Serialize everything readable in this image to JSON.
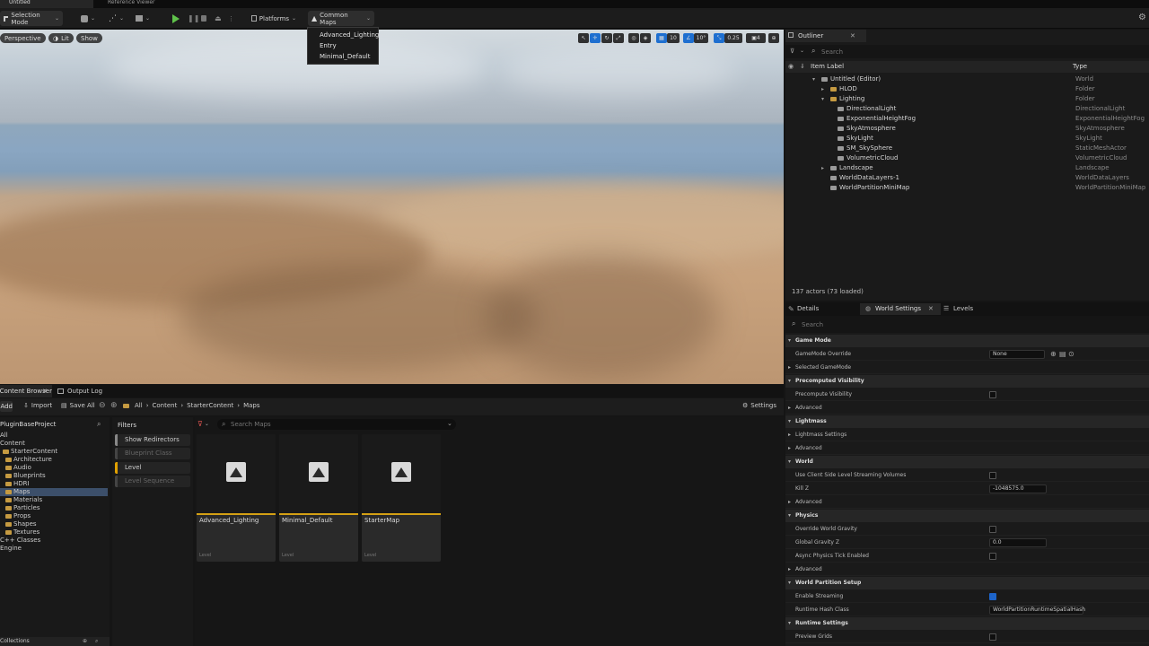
{
  "tabs": {
    "active": "Untitled",
    "second": "Reference Viewer"
  },
  "toolbar": {
    "selection_mode": "Selection Mode",
    "platforms": "Platforms",
    "common_maps": "Common Maps"
  },
  "maps_dropdown": {
    "items": [
      "Advanced_Lighting",
      "Entry",
      "Minimal_Default"
    ]
  },
  "viewport": {
    "perspective": "Perspective",
    "lit": "Lit",
    "show": "Show",
    "grid_snap": "10",
    "rot_snap": "10°",
    "scale_snap": "0.25",
    "camera_speed": "4"
  },
  "content_browser": {
    "tab_label": "Content Browser",
    "output_log": "Output Log",
    "add": "Add",
    "import": "Import",
    "save_all": "Save All",
    "crumbs": [
      "All",
      "Content",
      "StarterContent",
      "Maps"
    ],
    "settings": "Settings",
    "project": "PluginBaseProject",
    "tree": [
      {
        "label": "All",
        "indent": 0
      },
      {
        "label": "Content",
        "indent": 0
      },
      {
        "label": "StarterContent",
        "indent": 1
      },
      {
        "label": "Architecture",
        "indent": 2
      },
      {
        "label": "Audio",
        "indent": 2
      },
      {
        "label": "Blueprints",
        "indent": 2
      },
      {
        "label": "HDRI",
        "indent": 2
      },
      {
        "label": "Maps",
        "indent": 2
      },
      {
        "label": "Materials",
        "indent": 2
      },
      {
        "label": "Particles",
        "indent": 2
      },
      {
        "label": "Props",
        "indent": 2
      },
      {
        "label": "Shapes",
        "indent": 2
      },
      {
        "label": "Textures",
        "indent": 2
      },
      {
        "label": "C++ Classes",
        "indent": 0
      },
      {
        "label": "Engine",
        "indent": 0
      }
    ],
    "collections": "Collections",
    "filters_title": "Filters",
    "filters": [
      "Show Redirectors",
      "Blueprint Class",
      "Level",
      "Level Sequence"
    ],
    "search_placeholder": "Search Maps",
    "assets": [
      {
        "name": "Advanced_Lighting",
        "type": "Level"
      },
      {
        "name": "Minimal_Default",
        "type": "Level"
      },
      {
        "name": "StarterMap",
        "type": "Level"
      }
    ]
  },
  "outliner": {
    "tab": "Outliner",
    "search_placeholder": "Search",
    "col_label": "Item Label",
    "col_type": "Type",
    "rows": [
      {
        "label": "Untitled (Editor)",
        "type": "World",
        "indent": 0
      },
      {
        "label": "HLOD",
        "type": "Folder",
        "indent": 1
      },
      {
        "label": "Lighting",
        "type": "Folder",
        "indent": 1
      },
      {
        "label": "DirectionalLight",
        "type": "DirectionalLight",
        "indent": 2
      },
      {
        "label": "ExponentialHeightFog",
        "type": "ExponentialHeightFog",
        "indent": 2
      },
      {
        "label": "SkyAtmosphere",
        "type": "SkyAtmosphere",
        "indent": 2
      },
      {
        "label": "SkyLight",
        "type": "SkyLight",
        "indent": 2
      },
      {
        "label": "SM_SkySphere",
        "type": "StaticMeshActor",
        "indent": 2
      },
      {
        "label": "VolumetricCloud",
        "type": "VolumetricCloud",
        "indent": 2
      },
      {
        "label": "Landscape",
        "type": "Landscape",
        "indent": 1
      },
      {
        "label": "WorldDataLayers-1",
        "type": "WorldDataLayers",
        "indent": 1
      },
      {
        "label": "WorldPartitionMiniMap",
        "type": "WorldPartitionMiniMap",
        "indent": 1
      }
    ],
    "actor_count": "137 actors (73 loaded)"
  },
  "details": {
    "tab_details": "Details",
    "tab_world": "World Settings",
    "tab_levels": "Levels",
    "search_placeholder": "Search",
    "rows": [
      {
        "kind": "section",
        "label": "Game Mode"
      },
      {
        "kind": "row",
        "label": "GameMode Override",
        "value": "None"
      },
      {
        "kind": "row",
        "label": "Selected GameMode"
      },
      {
        "kind": "section",
        "label": "Precomputed Visibility"
      },
      {
        "kind": "row",
        "label": "Precompute Visibility",
        "check": false
      },
      {
        "kind": "row",
        "label": "Advanced"
      },
      {
        "kind": "section",
        "label": "Lightmass"
      },
      {
        "kind": "row",
        "label": "Lightmass Settings"
      },
      {
        "kind": "row",
        "label": "Advanced"
      },
      {
        "kind": "section",
        "label": "World"
      },
      {
        "kind": "row",
        "label": "Use Client Side Level Streaming Volumes",
        "check": false
      },
      {
        "kind": "row",
        "label": "Kill Z",
        "value": "-1048575.0"
      },
      {
        "kind": "row",
        "label": "Advanced"
      },
      {
        "kind": "section",
        "label": "Physics"
      },
      {
        "kind": "row",
        "label": "Override World Gravity",
        "check": false
      },
      {
        "kind": "row",
        "label": "Global Gravity Z",
        "value": "0.0"
      },
      {
        "kind": "row",
        "label": "Async Physics Tick Enabled",
        "check": false
      },
      {
        "kind": "row",
        "label": "Advanced"
      },
      {
        "kind": "section",
        "label": "World Partition Setup"
      },
      {
        "kind": "row",
        "label": "Enable Streaming",
        "check": true
      },
      {
        "kind": "row",
        "label": "Runtime Hash Class",
        "value": "WorldPartitionRuntimeSpatialHash"
      },
      {
        "kind": "section",
        "label": "Runtime Settings"
      },
      {
        "kind": "row",
        "label": "Preview Grids",
        "check": false
      }
    ]
  },
  "colors": {
    "accent": "#1d64c9",
    "level": "#d4a014",
    "play": "#5fc24a"
  }
}
